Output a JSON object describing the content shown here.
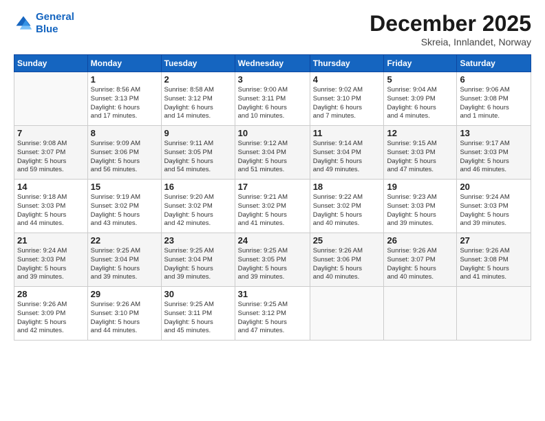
{
  "header": {
    "logo_line1": "General",
    "logo_line2": "Blue",
    "month": "December 2025",
    "location": "Skreia, Innlandet, Norway"
  },
  "weekdays": [
    "Sunday",
    "Monday",
    "Tuesday",
    "Wednesday",
    "Thursday",
    "Friday",
    "Saturday"
  ],
  "weeks": [
    [
      {
        "day": "",
        "info": ""
      },
      {
        "day": "1",
        "info": "Sunrise: 8:56 AM\nSunset: 3:13 PM\nDaylight: 6 hours\nand 17 minutes."
      },
      {
        "day": "2",
        "info": "Sunrise: 8:58 AM\nSunset: 3:12 PM\nDaylight: 6 hours\nand 14 minutes."
      },
      {
        "day": "3",
        "info": "Sunrise: 9:00 AM\nSunset: 3:11 PM\nDaylight: 6 hours\nand 10 minutes."
      },
      {
        "day": "4",
        "info": "Sunrise: 9:02 AM\nSunset: 3:10 PM\nDaylight: 6 hours\nand 7 minutes."
      },
      {
        "day": "5",
        "info": "Sunrise: 9:04 AM\nSunset: 3:09 PM\nDaylight: 6 hours\nand 4 minutes."
      },
      {
        "day": "6",
        "info": "Sunrise: 9:06 AM\nSunset: 3:08 PM\nDaylight: 6 hours\nand 1 minute."
      }
    ],
    [
      {
        "day": "7",
        "info": "Sunrise: 9:08 AM\nSunset: 3:07 PM\nDaylight: 5 hours\nand 59 minutes."
      },
      {
        "day": "8",
        "info": "Sunrise: 9:09 AM\nSunset: 3:06 PM\nDaylight: 5 hours\nand 56 minutes."
      },
      {
        "day": "9",
        "info": "Sunrise: 9:11 AM\nSunset: 3:05 PM\nDaylight: 5 hours\nand 54 minutes."
      },
      {
        "day": "10",
        "info": "Sunrise: 9:12 AM\nSunset: 3:04 PM\nDaylight: 5 hours\nand 51 minutes."
      },
      {
        "day": "11",
        "info": "Sunrise: 9:14 AM\nSunset: 3:04 PM\nDaylight: 5 hours\nand 49 minutes."
      },
      {
        "day": "12",
        "info": "Sunrise: 9:15 AM\nSunset: 3:03 PM\nDaylight: 5 hours\nand 47 minutes."
      },
      {
        "day": "13",
        "info": "Sunrise: 9:17 AM\nSunset: 3:03 PM\nDaylight: 5 hours\nand 46 minutes."
      }
    ],
    [
      {
        "day": "14",
        "info": "Sunrise: 9:18 AM\nSunset: 3:03 PM\nDaylight: 5 hours\nand 44 minutes."
      },
      {
        "day": "15",
        "info": "Sunrise: 9:19 AM\nSunset: 3:02 PM\nDaylight: 5 hours\nand 43 minutes."
      },
      {
        "day": "16",
        "info": "Sunrise: 9:20 AM\nSunset: 3:02 PM\nDaylight: 5 hours\nand 42 minutes."
      },
      {
        "day": "17",
        "info": "Sunrise: 9:21 AM\nSunset: 3:02 PM\nDaylight: 5 hours\nand 41 minutes."
      },
      {
        "day": "18",
        "info": "Sunrise: 9:22 AM\nSunset: 3:02 PM\nDaylight: 5 hours\nand 40 minutes."
      },
      {
        "day": "19",
        "info": "Sunrise: 9:23 AM\nSunset: 3:03 PM\nDaylight: 5 hours\nand 39 minutes."
      },
      {
        "day": "20",
        "info": "Sunrise: 9:24 AM\nSunset: 3:03 PM\nDaylight: 5 hours\nand 39 minutes."
      }
    ],
    [
      {
        "day": "21",
        "info": "Sunrise: 9:24 AM\nSunset: 3:03 PM\nDaylight: 5 hours\nand 39 minutes."
      },
      {
        "day": "22",
        "info": "Sunrise: 9:25 AM\nSunset: 3:04 PM\nDaylight: 5 hours\nand 39 minutes."
      },
      {
        "day": "23",
        "info": "Sunrise: 9:25 AM\nSunset: 3:04 PM\nDaylight: 5 hours\nand 39 minutes."
      },
      {
        "day": "24",
        "info": "Sunrise: 9:25 AM\nSunset: 3:05 PM\nDaylight: 5 hours\nand 39 minutes."
      },
      {
        "day": "25",
        "info": "Sunrise: 9:26 AM\nSunset: 3:06 PM\nDaylight: 5 hours\nand 40 minutes."
      },
      {
        "day": "26",
        "info": "Sunrise: 9:26 AM\nSunset: 3:07 PM\nDaylight: 5 hours\nand 40 minutes."
      },
      {
        "day": "27",
        "info": "Sunrise: 9:26 AM\nSunset: 3:08 PM\nDaylight: 5 hours\nand 41 minutes."
      }
    ],
    [
      {
        "day": "28",
        "info": "Sunrise: 9:26 AM\nSunset: 3:09 PM\nDaylight: 5 hours\nand 42 minutes."
      },
      {
        "day": "29",
        "info": "Sunrise: 9:26 AM\nSunset: 3:10 PM\nDaylight: 5 hours\nand 44 minutes."
      },
      {
        "day": "30",
        "info": "Sunrise: 9:25 AM\nSunset: 3:11 PM\nDaylight: 5 hours\nand 45 minutes."
      },
      {
        "day": "31",
        "info": "Sunrise: 9:25 AM\nSunset: 3:12 PM\nDaylight: 5 hours\nand 47 minutes."
      },
      {
        "day": "",
        "info": ""
      },
      {
        "day": "",
        "info": ""
      },
      {
        "day": "",
        "info": ""
      }
    ]
  ]
}
